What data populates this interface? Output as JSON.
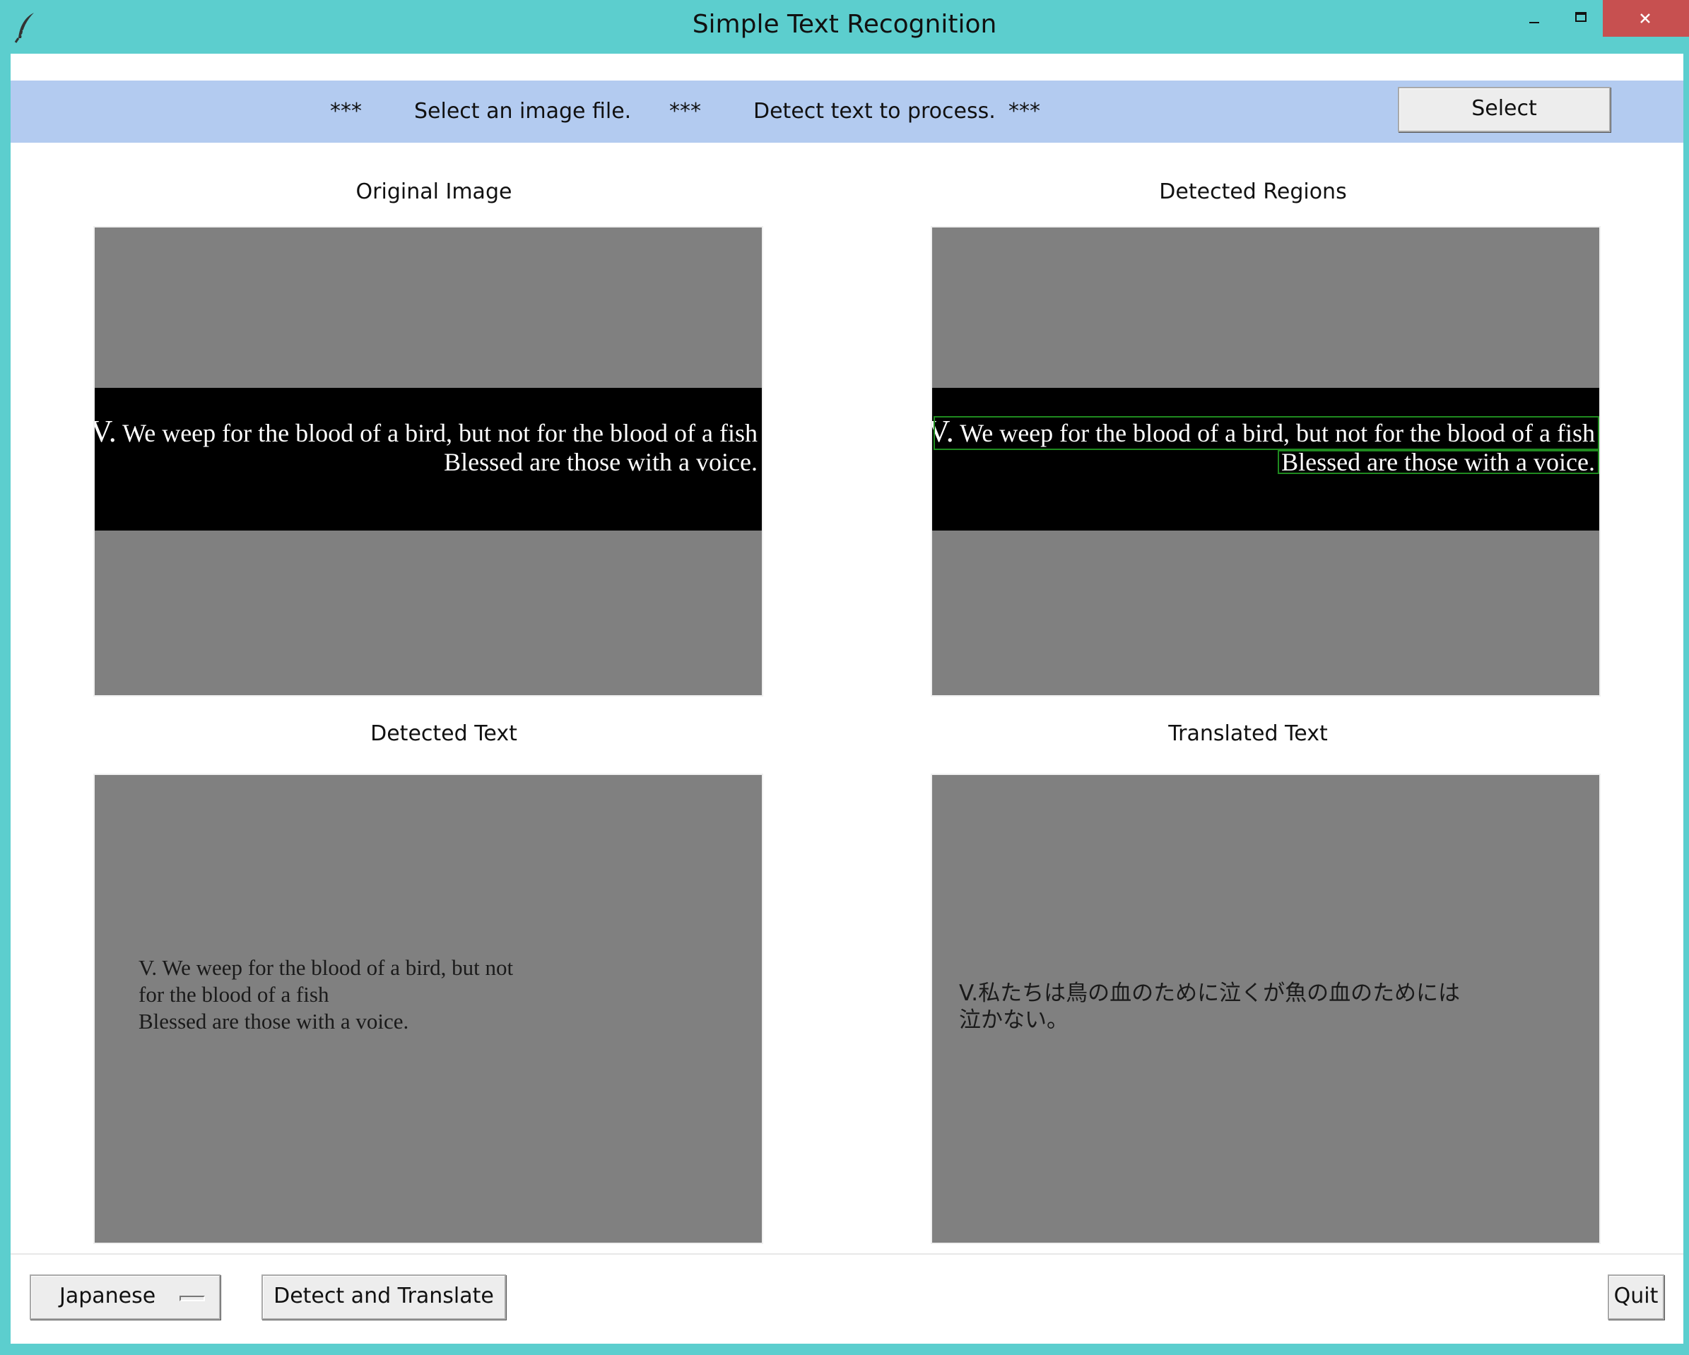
{
  "window": {
    "title": "Simple Text Recognition",
    "icons": [
      "feather-icon",
      "minimize-icon",
      "maximize-icon",
      "close-icon"
    ]
  },
  "banner": {
    "sep1": "***",
    "step1": "Select an image file.",
    "sep2": "***",
    "step2": "Detect text to process.",
    "sep3": "***",
    "select_label": "Select"
  },
  "panels": {
    "original": {
      "label": "Original Image",
      "line1_v": "V.",
      "line1": " We weep for the blood of a bird, but not for the blood of a fish",
      "line2": "Blessed are those with a voice."
    },
    "regions": {
      "label": "Detected Regions",
      "line1_v": "V.",
      "line1": " We weep for the blood of a bird, but not for the blood of a fish",
      "line2": "Blessed are those with a voice."
    },
    "detected": {
      "label": "Detected Text",
      "lines": [
        "V. We weep for the blood of a bird, but not",
        "for the blood of a fish",
        "Blessed are those with a voice."
      ]
    },
    "translated": {
      "label": "Translated Text",
      "lines": [
        "V.私たちは鳥の血のために泣くが魚の血のためには",
        "泣かない。"
      ]
    }
  },
  "bottom": {
    "language": "Japanese",
    "detect_label": "Detect and Translate",
    "quit_label": "Quit"
  },
  "colors": {
    "frame": "#5ccece",
    "banner": "#b3cbf0",
    "panel": "#808080",
    "close": "#c75050",
    "region_box": "#1f8a1f"
  }
}
